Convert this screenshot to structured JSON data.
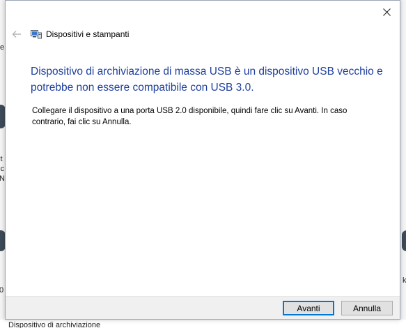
{
  "background": {
    "left_fragments": [
      "e",
      "it",
      "ic",
      "N",
      "0"
    ],
    "right_fragments": [
      "k"
    ],
    "bottom_label": "Dispositivo di archiviazione"
  },
  "dialog": {
    "title": "Dispositivi e stampanti",
    "heading": "Dispositivo di archiviazione di massa USB è un dispositivo USB vecchio e potrebbe non essere compatibile con USB 3.0.",
    "body": "Collegare il dispositivo a una porta USB 2.0 disponibile, quindi fare clic su Avanti. In caso contrario, fai clic su Annulla.",
    "buttons": {
      "next": "Avanti",
      "cancel": "Annulla"
    }
  },
  "colors": {
    "heading": "#1e3f9e",
    "accent": "#0078d7"
  },
  "icons": {
    "back": "back-arrow-icon",
    "close": "close-icon",
    "app": "devices-printers-icon"
  }
}
